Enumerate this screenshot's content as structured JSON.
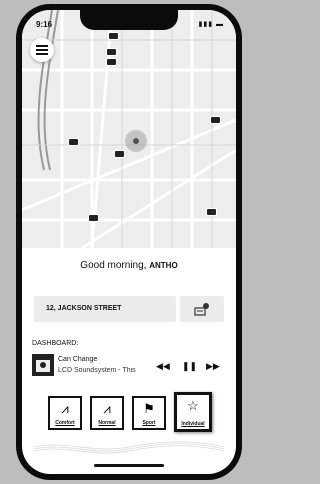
{
  "status": {
    "time": "9:16"
  },
  "greeting": {
    "text": "Good morning,",
    "name": "ANTHO"
  },
  "destination": {
    "address": "12, JACKSON STREET"
  },
  "dashboard": {
    "label": "DASHBOARD:"
  },
  "music": {
    "title": "Can Change",
    "artist": "LCD Soundsystem - This"
  },
  "modes": [
    {
      "label": "Comfort",
      "icon": "road-icon"
    },
    {
      "label": "Normal",
      "icon": "road-icon"
    },
    {
      "label": "Sport",
      "icon": "flag-icon"
    },
    {
      "label": "Individual",
      "icon": "star-road-icon"
    }
  ],
  "colors": {
    "background": "#bdbdbd",
    "map": "#ededed",
    "phone": "#0b0b0b"
  }
}
